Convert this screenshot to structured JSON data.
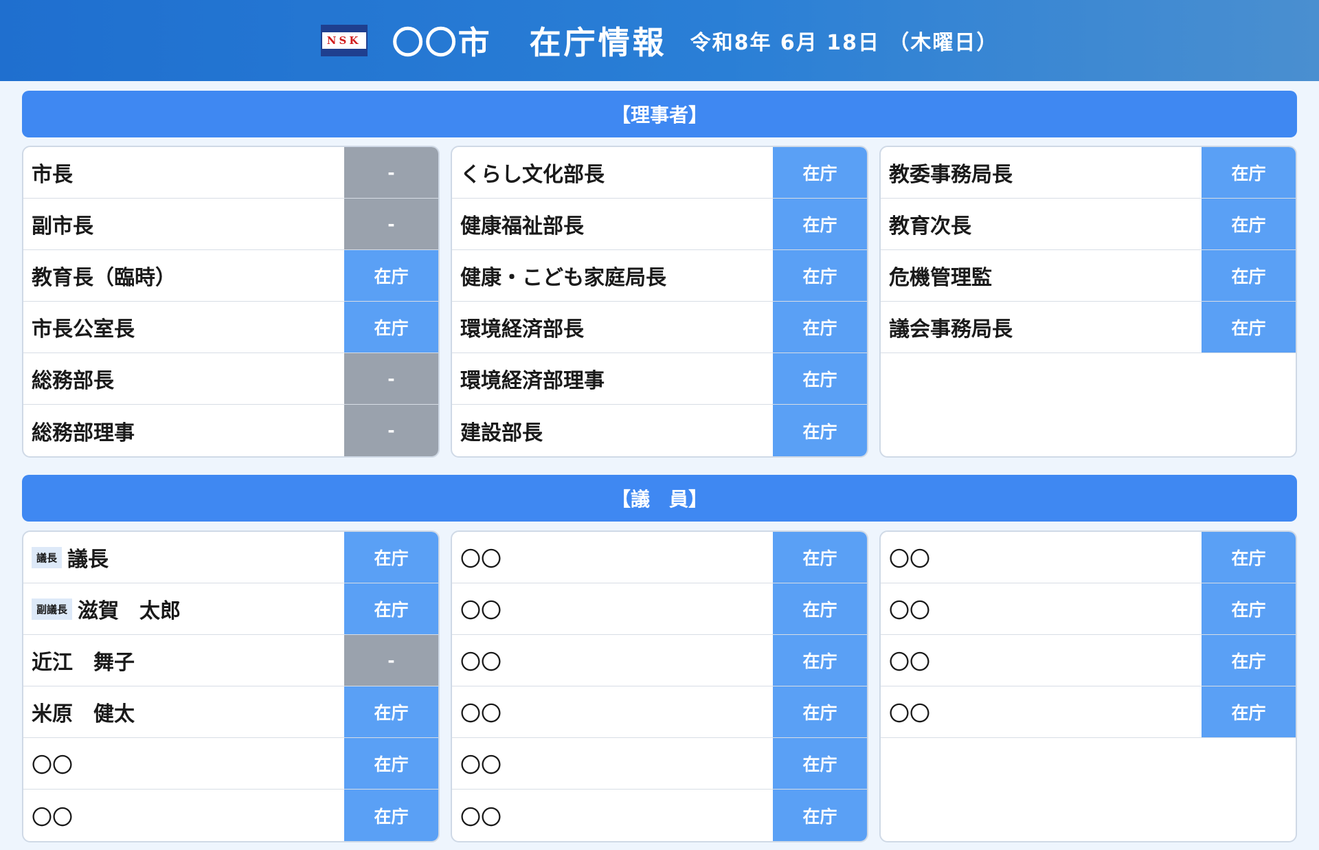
{
  "header": {
    "logo_text": "NSK",
    "city": "〇〇市",
    "title": "在庁情報",
    "date": "令和8年 6月 18日 （木曜日）"
  },
  "colors": {
    "present": "#5aa0f5",
    "absent": "#9aa2ad",
    "section": "#3f88f2"
  },
  "officials": {
    "heading": "【理事者】",
    "columns": [
      [
        {
          "name": "市長",
          "status": "-"
        },
        {
          "name": "副市長",
          "status": "-"
        },
        {
          "name": "教育長（臨時）",
          "status": "在庁"
        },
        {
          "name": "市長公室長",
          "status": "在庁"
        },
        {
          "name": "総務部長",
          "status": "-"
        },
        {
          "name": "総務部理事",
          "status": "-"
        }
      ],
      [
        {
          "name": "くらし文化部長",
          "status": "在庁"
        },
        {
          "name": "健康福祉部長",
          "status": "在庁"
        },
        {
          "name": "健康・こども家庭局長",
          "status": "在庁"
        },
        {
          "name": "環境経済部長",
          "status": "在庁"
        },
        {
          "name": "環境経済部理事",
          "status": "在庁"
        },
        {
          "name": "建設部長",
          "status": "在庁"
        }
      ],
      [
        {
          "name": "教委事務局長",
          "status": "在庁"
        },
        {
          "name": "教育次長",
          "status": "在庁"
        },
        {
          "name": "危機管理監",
          "status": "在庁"
        },
        {
          "name": "議会事務局長",
          "status": "在庁"
        }
      ]
    ]
  },
  "members": {
    "heading": "【議　員】",
    "columns": [
      [
        {
          "role": "議長",
          "name": "議長",
          "status": "在庁"
        },
        {
          "role": "副議長",
          "name": "滋賀　太郎",
          "status": "在庁"
        },
        {
          "name": "近江　舞子",
          "status": "-"
        },
        {
          "name": "米原　健太",
          "status": "在庁"
        },
        {
          "name": "〇〇",
          "status": "在庁"
        },
        {
          "name": "〇〇",
          "status": "在庁"
        }
      ],
      [
        {
          "name": "〇〇",
          "status": "在庁"
        },
        {
          "name": "〇〇",
          "status": "在庁"
        },
        {
          "name": "〇〇",
          "status": "在庁"
        },
        {
          "name": "〇〇",
          "status": "在庁"
        },
        {
          "name": "〇〇",
          "status": "在庁"
        },
        {
          "name": "〇〇",
          "status": "在庁"
        }
      ],
      [
        {
          "name": "〇〇",
          "status": "在庁"
        },
        {
          "name": "〇〇",
          "status": "在庁"
        },
        {
          "name": "〇〇",
          "status": "在庁"
        },
        {
          "name": "〇〇",
          "status": "在庁"
        }
      ]
    ]
  }
}
